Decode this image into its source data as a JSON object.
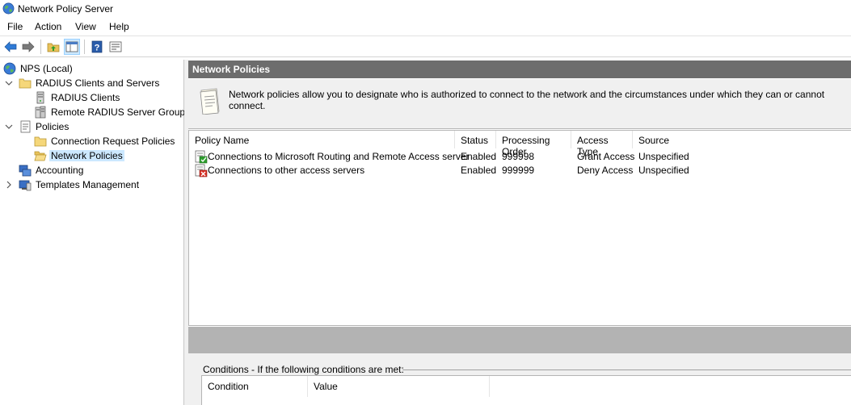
{
  "window": {
    "title": "Network Policy Server"
  },
  "menu": [
    "File",
    "Action",
    "View",
    "Help"
  ],
  "toolbar": {
    "buttons": [
      "back-arrow-icon",
      "forward-arrow-icon",
      "up-folder-icon",
      "show-hide-tree-icon",
      "help-icon",
      "properties-icon"
    ]
  },
  "tree": {
    "root": "NPS (Local)",
    "radius_group": "RADIUS Clients and Servers",
    "radius_clients": "RADIUS Clients",
    "remote_groups": "Remote RADIUS Server Groups",
    "policies": "Policies",
    "connection_request": "Connection Request Policies",
    "network_policies": "Network Policies",
    "accounting": "Accounting",
    "templates": "Templates Management"
  },
  "content": {
    "header": "Network Policies",
    "description": "Network policies allow you to designate who is authorized to connect to the network and the circumstances under which they can or cannot connect."
  },
  "policy_table": {
    "columns": [
      "Policy Name",
      "Status",
      "Processing Order",
      "Access Type",
      "Source"
    ],
    "rows": [
      {
        "name": "Connections to Microsoft Routing and Remote Access server",
        "status": "Enabled",
        "order": "999998",
        "access": "Grant Access",
        "source": "Unspecified",
        "icon": "grant-policy-icon"
      },
      {
        "name": "Connections to other access servers",
        "status": "Enabled",
        "order": "999999",
        "access": "Deny Access",
        "source": "Unspecified",
        "icon": "deny-policy-icon"
      }
    ]
  },
  "conditions": {
    "label": "Conditions - If the following conditions are met:",
    "columns": [
      "Condition",
      "Value"
    ]
  },
  "colors": {
    "header_bg": "#6d6d6d",
    "selection": "#cce8ff",
    "panel_bg": "#f0f0f0",
    "band": "#b3b3b3"
  }
}
